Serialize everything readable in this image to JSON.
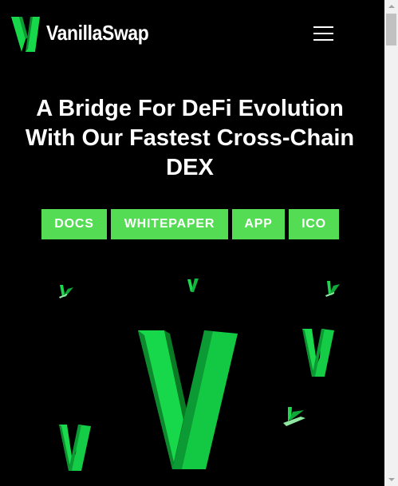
{
  "header": {
    "brand_name": "VanillaSwap",
    "logo_icon": "vanilla-v-logo-icon",
    "menu_icon": "hamburger-menu-icon"
  },
  "hero": {
    "title_lines": [
      "A Bridge For DeFi Evolution",
      "With Our Fastest Cross-Chain",
      "DEX"
    ],
    "buttons": [
      {
        "label": "DOCS"
      },
      {
        "label": "WHITEPAPER"
      },
      {
        "label": "APP"
      },
      {
        "label": "ICO"
      }
    ]
  },
  "colors": {
    "background": "#000000",
    "accent_green": "#55dc55",
    "logo_green": "#17d84a",
    "logo_dark_green": "#0a8a2a",
    "text": "#ffffff"
  },
  "decorations": {
    "icon": "floating-green-v-logo-icon"
  }
}
